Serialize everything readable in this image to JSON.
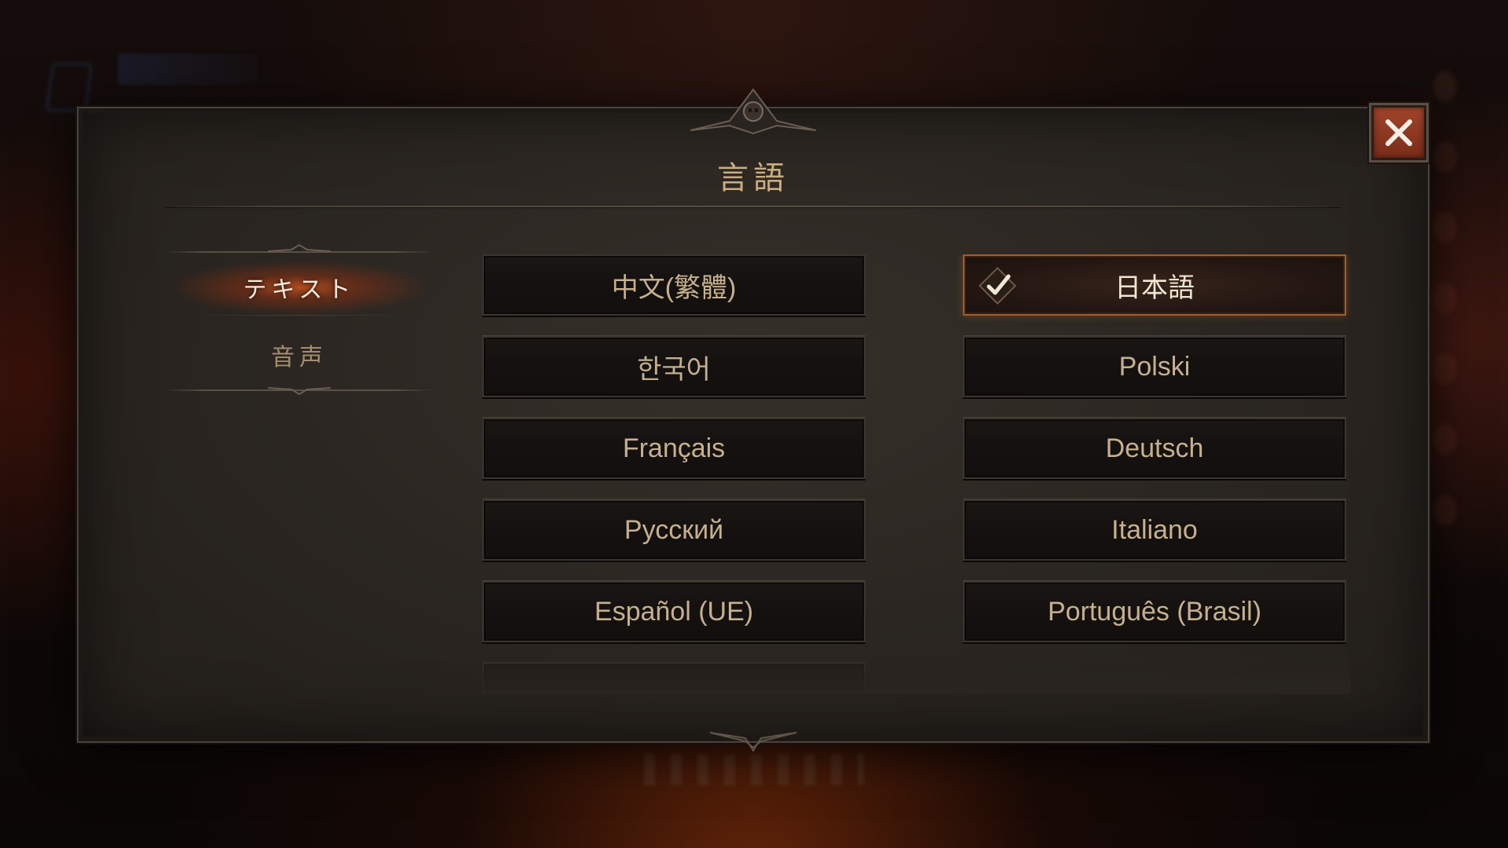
{
  "dialog": {
    "title": "言語",
    "close_icon": "close-icon"
  },
  "tabs": [
    {
      "label": "テキスト",
      "active": true
    },
    {
      "label": "音声",
      "active": false
    }
  ],
  "languages": {
    "left": [
      {
        "label": "中文(繁體)"
      },
      {
        "label": "한국어"
      },
      {
        "label": "Français"
      },
      {
        "label": "Русский"
      },
      {
        "label": "Español (UE)"
      }
    ],
    "right": [
      {
        "label": "日本語",
        "selected": true,
        "icon": "checkmark-icon"
      },
      {
        "label": "Polski"
      },
      {
        "label": "Deutsch"
      },
      {
        "label": "Italiano"
      },
      {
        "label": "Português (Brasil)"
      }
    ]
  },
  "colors": {
    "accent": "#a35d2b",
    "active_tab_glow": "#dc5a1e",
    "text_gold": "#c6b08d",
    "close_button": "#a2452a"
  }
}
